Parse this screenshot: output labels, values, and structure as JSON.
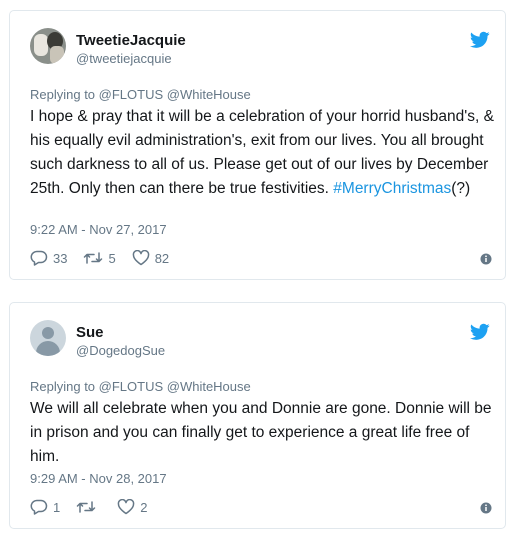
{
  "tweets": [
    {
      "name": "TweetieJacquie",
      "handle": "@tweetiejacquie",
      "replying_to": "Replying to @FLOTUS @WhiteHouse",
      "text": "I hope & pray that it will be a celebration of your horrid husband's, & his equally evil administration's, exit from our lives. You all brought such darkness to all of us. Please get out of our lives by December 25th. Only then can there be true festivities. ",
      "hashtag": "#MerryChristmas",
      "text_after": "(?)",
      "time": "9:22 AM - Nov 27, 2017",
      "replies": "33",
      "retweets": "5",
      "likes": "82"
    },
    {
      "name": "Sue",
      "handle": "@DogedogSue",
      "replying_to": "Replying to @FLOTUS @WhiteHouse",
      "text": "We will all celebrate when you and Donnie are gone. Donnie will be in prison and you can finally get to experience a great life free of him.",
      "time": "9:29 AM - Nov 28, 2017",
      "replies": "1",
      "retweets": "",
      "likes": "2"
    }
  ],
  "colors": {
    "twitter_blue": "#1da1f2",
    "link": "#1b95e0",
    "muted": "#657786"
  },
  "icons": [
    "twitter-bird-icon",
    "reply-icon",
    "retweet-icon",
    "like-icon",
    "info-icon"
  ]
}
